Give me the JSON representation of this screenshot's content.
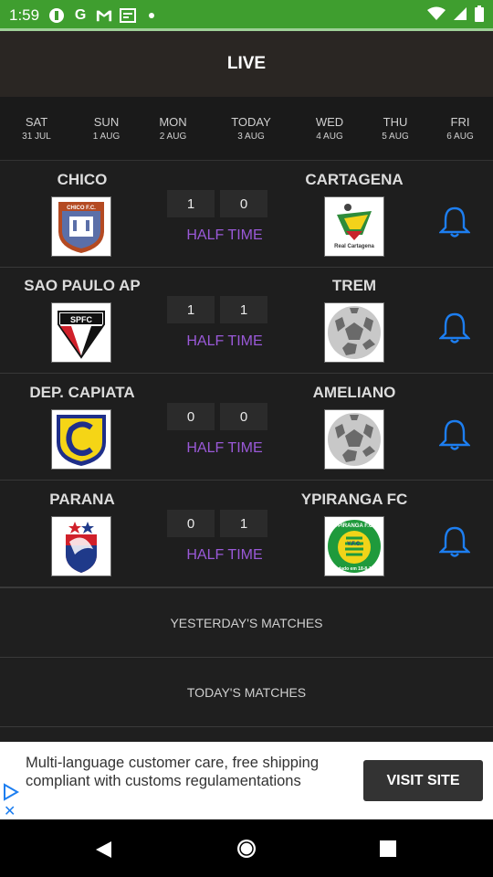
{
  "status_bar": {
    "time": "1:59",
    "icons": [
      "data-saver-icon",
      "google-icon",
      "gmail-icon",
      "news-icon",
      "dot-icon"
    ],
    "right_icons": [
      "wifi-icon",
      "signal-icon",
      "battery-icon"
    ]
  },
  "header": {
    "title": "LIVE"
  },
  "days": [
    {
      "name": "SAT",
      "date": "31 JUL"
    },
    {
      "name": "SUN",
      "date": "1 AUG"
    },
    {
      "name": "MON",
      "date": "2 AUG"
    },
    {
      "name": "TODAY",
      "date": "3 AUG"
    },
    {
      "name": "WED",
      "date": "4 AUG"
    },
    {
      "name": "THU",
      "date": "5 AUG"
    },
    {
      "name": "FRI",
      "date": "6 AUG"
    }
  ],
  "matches": [
    {
      "home": "CHICO",
      "away": "CARTAGENA",
      "home_score": "1",
      "away_score": "0",
      "status": "HALF TIME",
      "home_logo": "chico-crest-icon",
      "away_logo": "real-cartagena-crest-icon"
    },
    {
      "home": "SAO PAULO AP",
      "away": "TREM",
      "home_score": "1",
      "away_score": "1",
      "status": "HALF TIME",
      "home_logo": "spfc-crest-icon",
      "away_logo": "soccer-ball-icon"
    },
    {
      "home": "DEP. CAPIATA",
      "away": "AMELIANO",
      "home_score": "0",
      "away_score": "0",
      "status": "HALF TIME",
      "home_logo": "capiata-crest-icon",
      "away_logo": "soccer-ball-icon"
    },
    {
      "home": "PARANA",
      "away": "YPIRANGA FC",
      "home_score": "0",
      "away_score": "1",
      "status": "HALF TIME",
      "home_logo": "parana-crest-icon",
      "away_logo": "ypiranga-crest-icon"
    }
  ],
  "logo_text": {
    "chico": "CHICO F.C.",
    "cartagena": "Real Cartagena",
    "spfc": "SPFC",
    "ypiranga_top": "YPIRANGA F.C.",
    "ypiranga_mid": "Y.F.C.",
    "ypiranga_bottom": "Fundado em 18-8-1924"
  },
  "links": {
    "yesterday": "YESTERDAY'S MATCHES",
    "today": "TODAY'S MATCHES"
  },
  "ad": {
    "text": "Multi-language customer care, free shipping compliant with customs regulamentations",
    "button": "VISIT SITE"
  },
  "colors": {
    "status_bar": "#3f9e2f",
    "accent_purple": "#9a59d8",
    "bell_blue": "#1d7ef0"
  }
}
